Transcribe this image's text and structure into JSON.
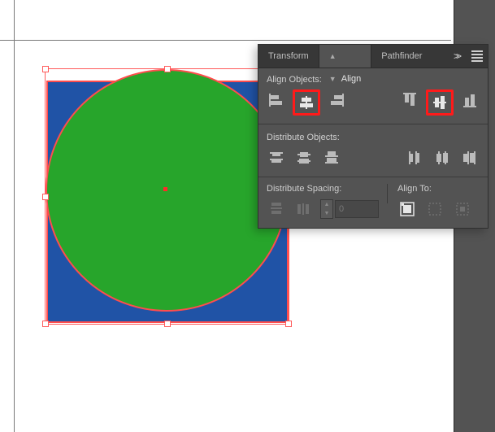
{
  "panel": {
    "tabs": {
      "transform": "Transform",
      "align": "Align",
      "pathfinder": "Pathfinder"
    },
    "section_align_objects": "Align Objects:",
    "section_distribute_objects": "Distribute Objects:",
    "section_distribute_spacing": "Distribute Spacing:",
    "section_align_to": "Align To:",
    "spacing_value": "0",
    "more_label": ">>"
  },
  "icons": {
    "align_left": "horizontal-align-left-icon",
    "align_hcenter": "horizontal-align-center-icon",
    "align_right": "horizontal-align-right-icon",
    "align_top": "vertical-align-top-icon",
    "align_vcenter": "vertical-align-center-icon",
    "align_bottom": "vertical-align-bottom-icon",
    "dist_top": "distribute-top-icon",
    "dist_vcenter": "distribute-vertical-center-icon",
    "dist_bottom": "distribute-bottom-icon",
    "dist_left": "distribute-left-icon",
    "dist_hcenter": "distribute-horizontal-center-icon",
    "dist_right": "distribute-right-icon",
    "dist_space_v": "distribute-vertical-space-icon",
    "dist_space_h": "distribute-horizontal-space-icon",
    "align_to_artboard": "align-to-artboard-icon",
    "align_to_selection": "align-to-selection-icon",
    "align_to_key": "align-to-key-object-icon"
  },
  "canvas": {
    "selection": "square-and-circle",
    "colors": {
      "square_fill": "#2053a6",
      "circle_fill": "#27a52b",
      "selection": "#ff5a5a"
    }
  }
}
